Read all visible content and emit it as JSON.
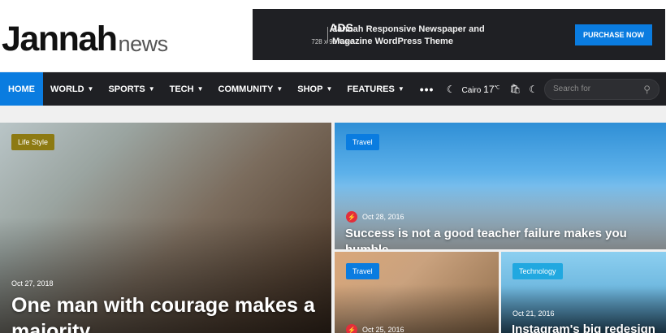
{
  "logo": {
    "main": "Jannah",
    "sub": "news"
  },
  "ad": {
    "title": "ADS",
    "subtitle": "728 x 90 Area!",
    "text": "Jannah Responsive Newspaper and Magazine WordPress Theme",
    "button": "PURCHASE NOW"
  },
  "nav": {
    "items": [
      {
        "label": "HOME",
        "active": true
      },
      {
        "label": "WORLD",
        "dropdown": true
      },
      {
        "label": "SPORTS",
        "dropdown": true
      },
      {
        "label": "TECH",
        "dropdown": true
      },
      {
        "label": "COMMUNITY",
        "dropdown": true
      },
      {
        "label": "SHOP",
        "dropdown": true
      },
      {
        "label": "FEATURES",
        "dropdown": true
      }
    ],
    "more": "•••",
    "weather_city": "Cairo",
    "weather_temp": "17",
    "weather_unit": "℃",
    "search_placeholder": "Search for"
  },
  "posts": {
    "main": {
      "category": "Life Style",
      "date": "Oct 27, 2018",
      "title": "One man with courage makes a majority"
    },
    "travel1": {
      "category": "Travel",
      "date": "Oct 28, 2016",
      "title": "Success is not a good teacher failure makes you humble"
    },
    "travel2": {
      "category": "Travel",
      "date": "Oct 25, 2016"
    },
    "tech": {
      "category": "Technology",
      "date": "Oct 21, 2016",
      "title": "Instagram's big redesign"
    }
  },
  "colors": {
    "accent": "#0a7ce0",
    "nav_bg": "#1f2024",
    "lifestyle_badge": "#8d7a12",
    "tech_badge": "#21a8e0",
    "bolt": "#e42e3a"
  }
}
